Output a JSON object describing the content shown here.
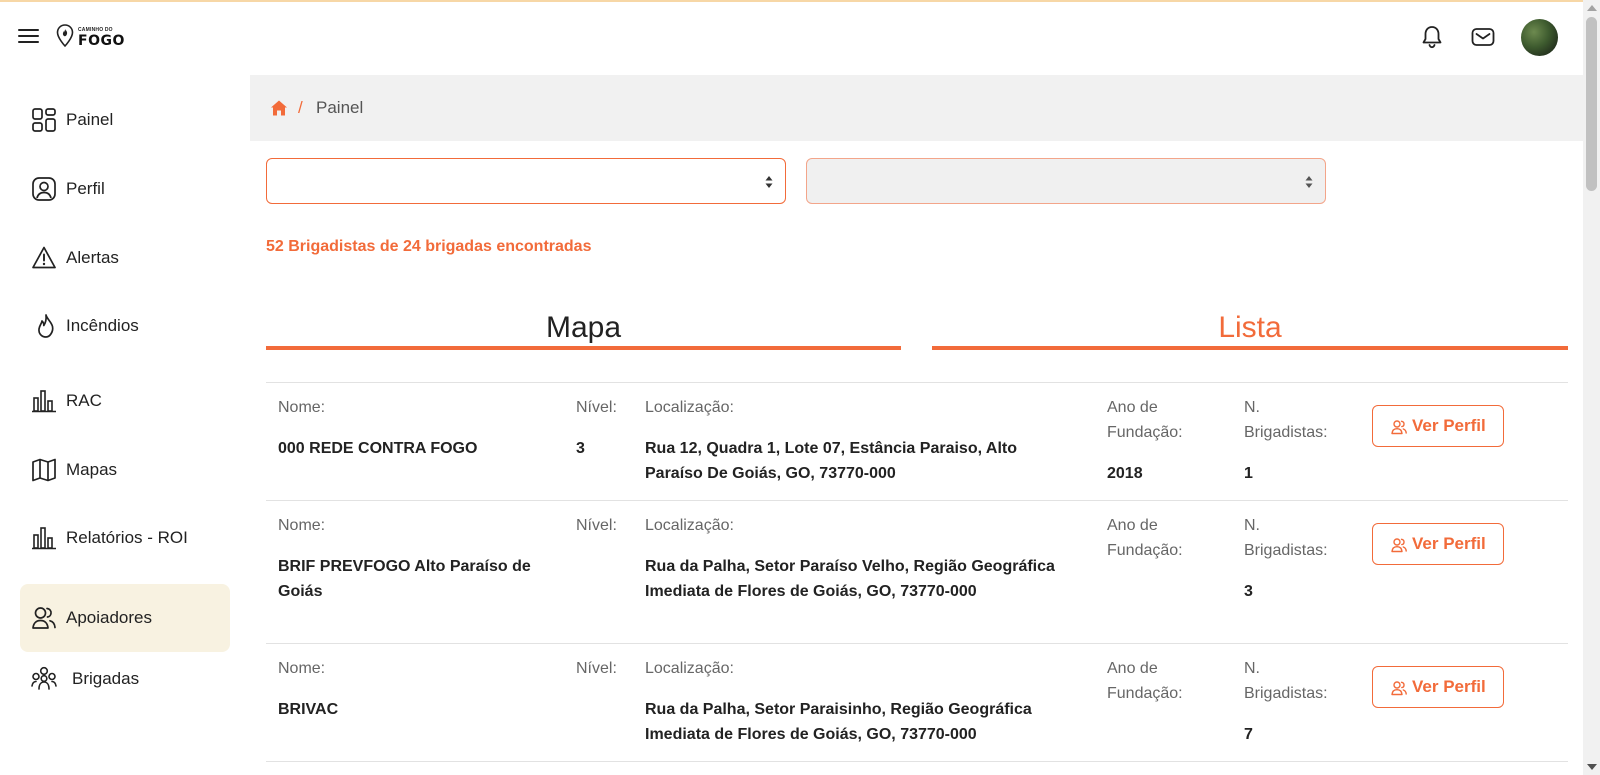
{
  "colors": {
    "accent": "#f26b3a",
    "active_bg": "#f8f2e1"
  },
  "logo": {
    "small_text": "CAMINHO DO",
    "big_text": "FOGO"
  },
  "sidebar": {
    "items": [
      {
        "label": "Painel",
        "icon": "dashboard-icon"
      },
      {
        "label": "Perfil",
        "icon": "user-icon"
      },
      {
        "label": "Alertas",
        "icon": "alert-icon"
      },
      {
        "label": "Incêndios",
        "icon": "fire-icon"
      },
      {
        "label": "RAC",
        "icon": "chart-icon"
      },
      {
        "label": "Mapas",
        "icon": "map-icon"
      },
      {
        "label": "Relatórios - ROI",
        "icon": "chart-icon"
      },
      {
        "label": "Apoiadores",
        "icon": "people-icon",
        "active": true
      },
      {
        "label": "Brigadas",
        "icon": "group-icon"
      }
    ]
  },
  "breadcrumb": {
    "separator": "/",
    "current": "Painel"
  },
  "filters": {
    "select1_value": "",
    "select2_value": ""
  },
  "summary": "52 Brigadistas de 24 brigadas encontradas",
  "tabs": {
    "map": "Mapa",
    "list": "Lista",
    "active": "list"
  },
  "columns": {
    "nome": "Nome:",
    "nivel": "Nível:",
    "localizacao": "Localização:",
    "ano_line1": "Ano de",
    "ano_line2": "Fundação:",
    "brig_line1": "N.",
    "brig_line2": "Brigadistas:"
  },
  "button_label": "Ver Perfil",
  "rows": [
    {
      "nome": "000 REDE CONTRA FOGO",
      "nivel": "3",
      "localizacao": "Rua 12, Quadra 1, Lote 07, Estância Paraiso, Alto Paraíso De Goiás, GO, 73770-000",
      "ano": "2018",
      "brigadistas": "1"
    },
    {
      "nome": "BRIF PREVFOGO Alto Paraíso de Goiás",
      "nivel": "",
      "localizacao": "Rua da Palha, Setor Paraíso Velho, Região Geográfica Imediata de Flores de Goiás, GO, 73770-000",
      "ano": "",
      "brigadistas": "3"
    },
    {
      "nome": "BRIVAC",
      "nivel": "",
      "localizacao": "Rua da Palha, Setor Paraisinho, Região Geográfica Imediata de Flores de Goiás, GO, 73770-000",
      "ano": "",
      "brigadistas": "7"
    }
  ]
}
